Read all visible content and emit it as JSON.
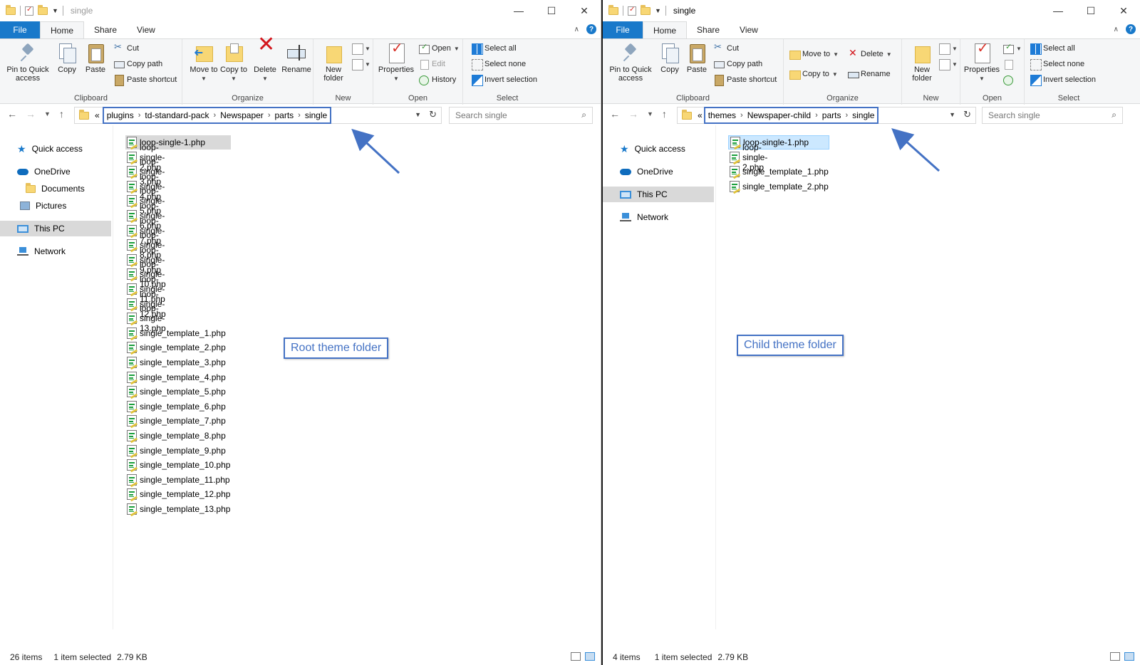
{
  "left": {
    "title": "single",
    "tabs": {
      "file": "File",
      "home": "Home",
      "share": "Share",
      "view": "View"
    },
    "ribbon": {
      "clipboard": {
        "label": "Clipboard",
        "pin": "Pin to Quick access",
        "copy": "Copy",
        "paste": "Paste",
        "cut": "Cut",
        "copy_path": "Copy path",
        "paste_shortcut": "Paste shortcut"
      },
      "organize": {
        "label": "Organize",
        "move_to": "Move to",
        "copy_to": "Copy to",
        "delete": "Delete",
        "rename": "Rename"
      },
      "new": {
        "label": "New",
        "new_folder": "New folder"
      },
      "open": {
        "label": "Open",
        "properties": "Properties",
        "open": "Open",
        "edit": "Edit",
        "history": "History"
      },
      "select": {
        "label": "Select",
        "select_all": "Select all",
        "select_none": "Select none",
        "invert": "Invert selection"
      }
    },
    "address": {
      "prefix": "«",
      "crumbs": [
        "plugins",
        "td-standard-pack",
        "Newspaper",
        "parts",
        "single"
      ]
    },
    "search_placeholder": "Search single",
    "nav": {
      "quick_access": "Quick access",
      "onedrive": "OneDrive",
      "documents": "Documents",
      "pictures": "Pictures",
      "this_pc": "This PC",
      "network": "Network"
    },
    "files": [
      "loop-single-1.php",
      "loop-single-2.php",
      "loop-single-3.php",
      "loop-single-4.php",
      "loop-single-5.php",
      "loop-single-6.php",
      "loop-single-7.php",
      "loop-single-8.php",
      "loop-single-9.php",
      "loop-single-10.php",
      "loop-single-11.php",
      "loop-single-12.php",
      "loop-single-13.php",
      "single_template_1.php",
      "single_template_2.php",
      "single_template_3.php",
      "single_template_4.php",
      "single_template_5.php",
      "single_template_6.php",
      "single_template_7.php",
      "single_template_8.php",
      "single_template_9.php",
      "single_template_10.php",
      "single_template_11.php",
      "single_template_12.php",
      "single_template_13.php"
    ],
    "callout": "Root theme folder",
    "status": {
      "count": "26 items",
      "selected": "1 item selected",
      "size": "2.79 KB"
    }
  },
  "right": {
    "title": "single",
    "tabs": {
      "file": "File",
      "home": "Home",
      "share": "Share",
      "view": "View"
    },
    "ribbon": {
      "clipboard": {
        "label": "Clipboard",
        "pin": "Pin to Quick access",
        "copy": "Copy",
        "paste": "Paste",
        "cut": "Cut",
        "copy_path": "Copy path",
        "paste_shortcut": "Paste shortcut"
      },
      "organize": {
        "label": "Organize",
        "move_to": "Move to",
        "copy_to": "Copy to",
        "delete": "Delete",
        "rename": "Rename"
      },
      "new": {
        "label": "New",
        "new_folder": "New folder"
      },
      "open": {
        "label": "Open",
        "properties": "Properties"
      },
      "select": {
        "label": "Select",
        "select_all": "Select all",
        "select_none": "Select none",
        "invert": "Invert selection"
      }
    },
    "address": {
      "prefix": "«",
      "crumbs": [
        "themes",
        "Newspaper-child",
        "parts",
        "single"
      ]
    },
    "search_placeholder": "Search single",
    "nav": {
      "quick_access": "Quick access",
      "onedrive": "OneDrive",
      "this_pc": "This PC",
      "network": "Network"
    },
    "files": [
      "loop-single-1.php",
      "loop-single-2.php",
      "single_template_1.php",
      "single_template_2.php"
    ],
    "callout": "Child theme folder",
    "status": {
      "count": "4 items",
      "selected": "1 item selected",
      "size": "2.79 KB"
    }
  },
  "colors": {
    "accent": "#1979ca",
    "annotation": "#4472c4",
    "selection_gray": "#d9d9d9",
    "selection_blue": "#cce8ff"
  }
}
